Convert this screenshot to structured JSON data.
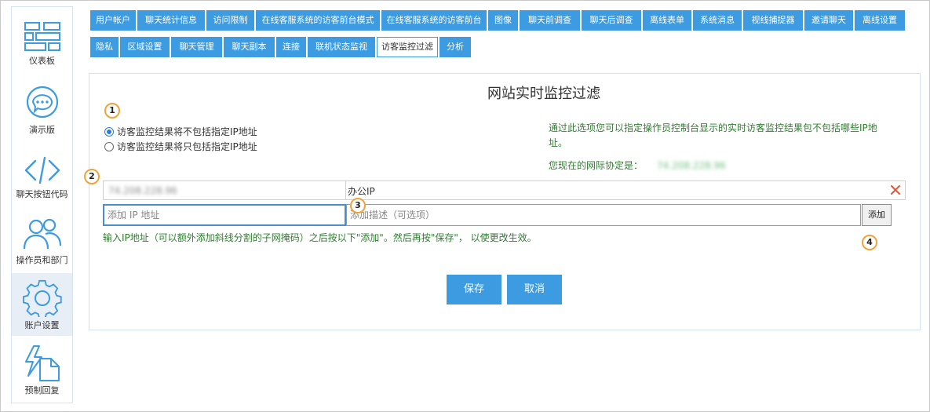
{
  "sidebar": {
    "items": [
      {
        "label": "仪表板",
        "icon": "dashboard-icon"
      },
      {
        "label": "演示版",
        "icon": "chat-bubble-icon"
      },
      {
        "label": "聊天按钮代码",
        "icon": "code-icon"
      },
      {
        "label": "操作员和部门",
        "icon": "users-icon"
      },
      {
        "label": "账户设置",
        "icon": "gear-icon"
      },
      {
        "label": "预制回复",
        "icon": "lightning-document-icon"
      }
    ],
    "active_index": 4
  },
  "tabs": {
    "row1": [
      "用户帐户",
      "聊天统计信息",
      "访问限制",
      "在线客服系统的访客前台模式",
      "在线客服系统的访客前台",
      "图像",
      "聊天前调查",
      "聊天后调查",
      "离线表单",
      "系统消息",
      "视线捕捉器",
      "邀请聊天",
      "离线设置"
    ],
    "row2": [
      "隐私",
      "区域设置",
      "聊天管理",
      "聊天副本",
      "连接",
      "联机状态监视",
      "访客监控过滤",
      "分析"
    ],
    "active": "访客监控过滤"
  },
  "panel": {
    "title": "网站实时监控过滤",
    "radio_options": [
      {
        "label": "访客监控结果将不包括指定IP地址",
        "checked": true
      },
      {
        "label": "访客监控结果将只包括指定IP地址",
        "checked": false
      }
    ],
    "info_text_line1": "通过此选项您可以指定操作员控制台显示的实时访客监控结果包不包括哪些IP地",
    "info_text_line2": "址。",
    "current_ip_label": "您现在的网际协定是：",
    "current_ip_value": "74.208.228.96",
    "ip_list": [
      {
        "ip": "74.208.228.96",
        "description": "办公IP"
      }
    ],
    "add_ip_placeholder": "添加 IP 地址",
    "add_desc_placeholder": "添加描述（可选项）",
    "add_button": "添加",
    "instruction": "输入IP地址（可以额外添加斜线分割的子网掩码）之后按以下\"添加\"。然后再按\"保存\"， 以使更改生效。",
    "save_button": "保存",
    "cancel_button": "取消"
  },
  "badges": [
    "1",
    "2",
    "3",
    "4"
  ],
  "colors": {
    "tab_blue": "#3d9be1",
    "hint_green": "#2f7d2f",
    "badge_orange": "#f0a33a",
    "delete_red": "#e0553a"
  }
}
